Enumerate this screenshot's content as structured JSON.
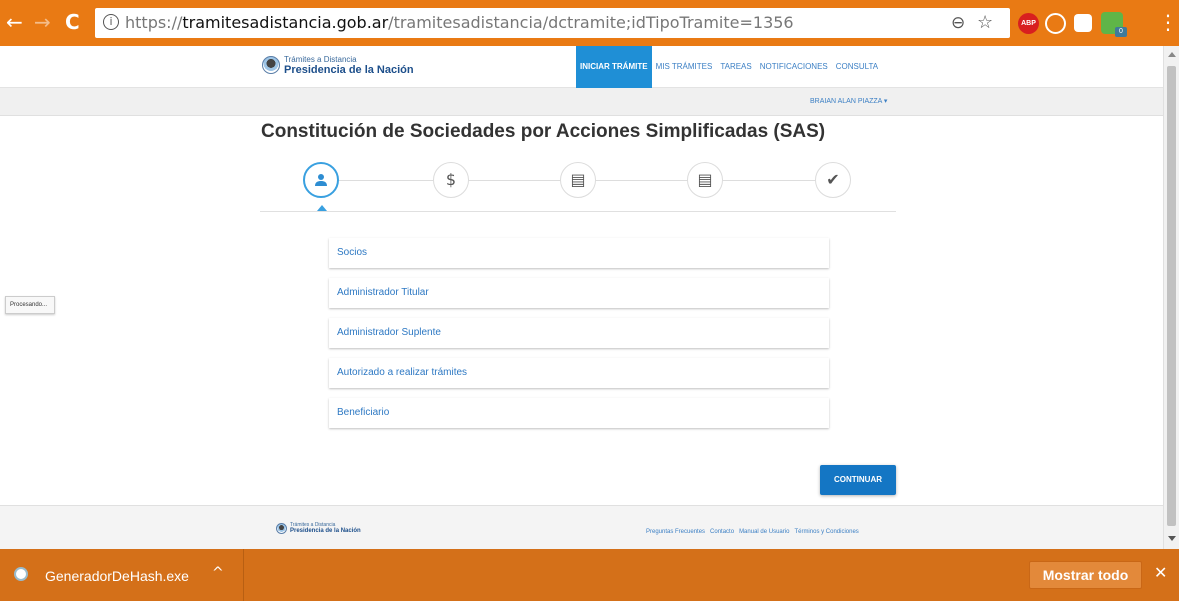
{
  "browser": {
    "back_glyph": "←",
    "forward_glyph": "→",
    "reload_glyph": "C",
    "url_scheme": "https://",
    "url_host": "tramitesadistancia.gob.ar",
    "url_path": "/tramitesadistancia/dctramite;idTipoTramite=1356",
    "zoom_glyph": "⊖",
    "star_glyph": "☆",
    "extensions": [
      "abp-icon",
      "sync-icon",
      "document-icon",
      "green-extension-icon"
    ],
    "abp_label": "ABP",
    "green_badge": "0",
    "menu_glyph": "⋮"
  },
  "header": {
    "logo_line1": "Trámites a Distancia",
    "logo_line2": "Presidencia de la Nación",
    "nav": [
      {
        "label": "INICIAR TRÁMITE",
        "active": true
      },
      {
        "label": "MIS TRÁMITES",
        "active": false
      },
      {
        "label": "TAREAS",
        "active": false
      },
      {
        "label": "NOTIFICACIONES",
        "active": false
      },
      {
        "label": "CONSULTA",
        "active": false
      }
    ],
    "user_name": "BRAIAN ALAN PIAZZA",
    "user_caret": "▾"
  },
  "main": {
    "title": "Constitución de Sociedades por Acciones Simplificadas (SAS)",
    "steps": [
      {
        "icon": "person-icon",
        "glyph": "👤",
        "active": true
      },
      {
        "icon": "dollar-icon",
        "glyph": "$",
        "active": false
      },
      {
        "icon": "form-icon",
        "glyph": "▤",
        "active": false
      },
      {
        "icon": "form-icon",
        "glyph": "▤",
        "active": false
      },
      {
        "icon": "check-icon",
        "glyph": "✔",
        "active": false
      }
    ],
    "sections": [
      "Socios",
      "Administrador Titular",
      "Administrador Suplente",
      "Autorizado a realizar trámites",
      "Beneficiario"
    ],
    "continue_label": "CONTINUAR",
    "status_text": "Procesando..."
  },
  "footer": {
    "logo_line1": "Trámites a Distancia",
    "logo_line2": "Presidencia de la Nación",
    "links": [
      "Preguntas Frecuentes",
      "Contacto",
      "Manual de Usuario",
      "Términos y Condiciones"
    ]
  },
  "download_bar": {
    "file_name": "GeneradorDeHash.exe",
    "caret": "^",
    "show_all_label": "Mostrar todo",
    "close_glyph": "✕"
  },
  "colors": {
    "chrome_orange": "#e97a14",
    "accent_blue": "#1f8fd6",
    "button_blue": "#1476c4",
    "link_blue": "#2d78c3"
  }
}
